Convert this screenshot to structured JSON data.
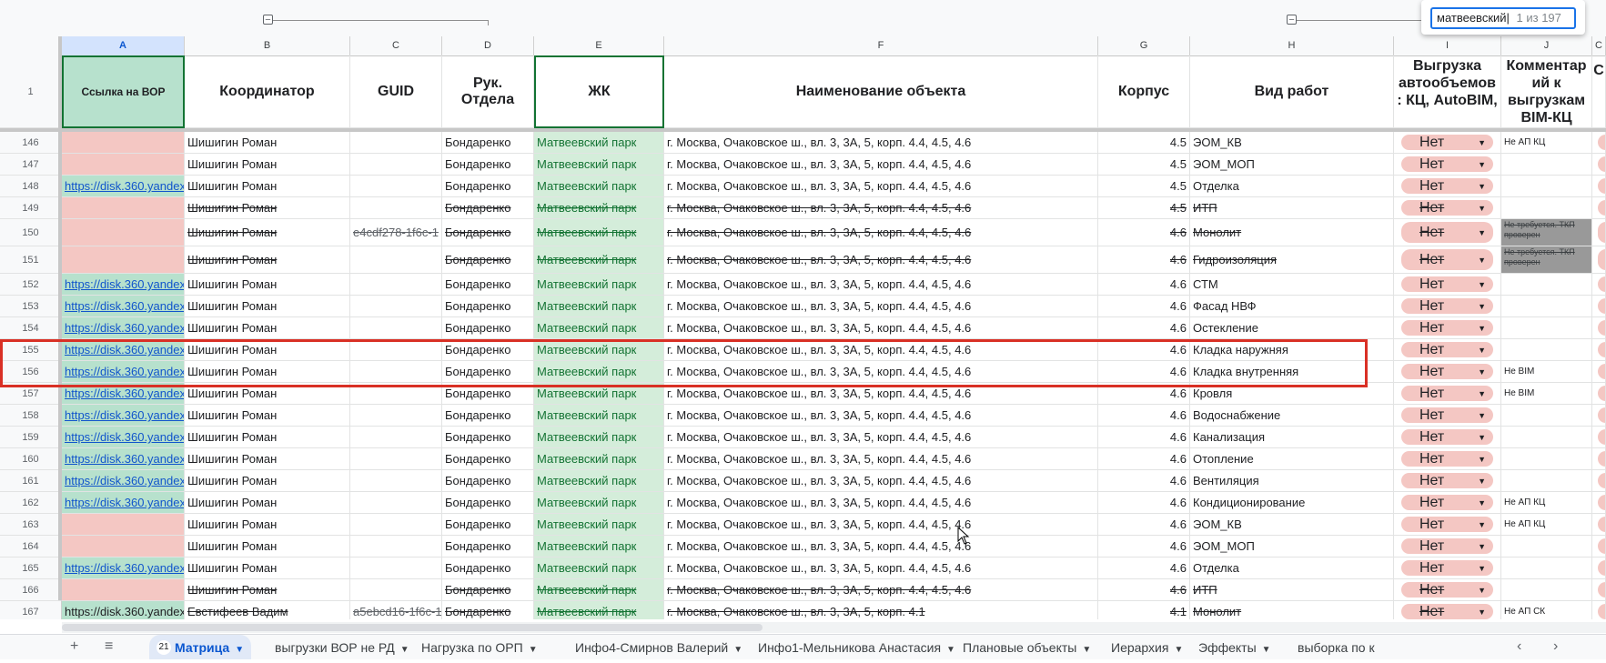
{
  "find": {
    "query": "матвеевский",
    "count": "1 из 197"
  },
  "columns": [
    "A",
    "B",
    "C",
    "D",
    "E",
    "F",
    "G",
    "H",
    "I",
    "J",
    "C"
  ],
  "header_row": {
    "num": "1",
    "A": "Ссылка на ВОР",
    "B": "Координатор",
    "C": "GUID",
    "D": "Рук. Отдела",
    "E": "ЖК",
    "F": "Наименование объекта",
    "G": "Корпус",
    "H": "Вид работ",
    "I": "Выгрузка автообъемов : КЦ, AutoBIM,",
    "J": "Комментар ий к выгрузкам BIM-КЦ",
    "K": "С"
  },
  "rows": [
    {
      "num": "146",
      "a": "",
      "b": "Шишигин Роман",
      "c": "",
      "d": "Бондаренко",
      "e": "Матвеевский парк",
      "f": "г. Москва, Очаковское ш., вл. 3, 3А, 5, корп. 4.4, 4.5, 4.6",
      "g": "4.5",
      "h": "ЭОМ_КВ",
      "i": "Нет",
      "j": "Не АП КЦ"
    },
    {
      "num": "147",
      "a": "",
      "b": "Шишигин Роман",
      "c": "",
      "d": "Бондаренко",
      "e": "Матвеевский парк",
      "f": "г. Москва, Очаковское ш., вл. 3, 3А, 5, корп. 4.4, 4.5, 4.6",
      "g": "4.5",
      "h": "ЭОМ_МОП",
      "i": "Нет",
      "j": ""
    },
    {
      "num": "148",
      "a": "https://disk.360.yandex",
      "b": "Шишигин Роман",
      "c": "",
      "d": "Бондаренко",
      "e": "Матвеевский парк",
      "f": "г. Москва, Очаковское ш., вл. 3, 3А, 5, корп. 4.4, 4.5, 4.6",
      "g": "4.5",
      "h": "Отделка",
      "i": "Нет",
      "j": ""
    },
    {
      "num": "149",
      "a": "",
      "b": "Шишигин Роман",
      "c": "",
      "d": "Бондаренко",
      "e": "Матвеевский парк",
      "f": "г. Москва, Очаковское ш., вл. 3, 3А, 5, корп. 4.4, 4.5, 4.6",
      "g": "4.5",
      "h": "ИТП",
      "i": "Нет",
      "j": ""
    },
    {
      "num": "150",
      "a": "",
      "b": "Шишигин Роман",
      "c": "e4cdf278-1f6c-1",
      "d": "Бондаренко",
      "e": "Матвеевский парк",
      "f": "г. Москва, Очаковское ш., вл. 3, 3А, 5, корп. 4.4, 4.5, 4.6",
      "g": "4.6",
      "h": "Монолит",
      "i": "Нет",
      "j": "Не требуется. ТКП проверен"
    },
    {
      "num": "151",
      "a": "",
      "b": "Шишигин Роман",
      "c": "",
      "d": "Бондаренко",
      "e": "Матвеевский парк",
      "f": "г. Москва, Очаковское ш., вл. 3, 3А, 5, корп. 4.4, 4.5, 4.6",
      "g": "4.6",
      "h": "Гидроизоляция",
      "i": "Нет",
      "j": "Не требуется. ТКП проверен"
    },
    {
      "num": "152",
      "a": "https://disk.360.yandex",
      "b": "Шишигин Роман",
      "c": "",
      "d": "Бондаренко",
      "e": "Матвеевский парк",
      "f": "г. Москва, Очаковское ш., вл. 3, 3А, 5, корп. 4.4, 4.5, 4.6",
      "g": "4.6",
      "h": "СТМ",
      "i": "Нет",
      "j": ""
    },
    {
      "num": "153",
      "a": "https://disk.360.yandex",
      "b": "Шишигин Роман",
      "c": "",
      "d": "Бондаренко",
      "e": "Матвеевский парк",
      "f": "г. Москва, Очаковское ш., вл. 3, 3А, 5, корп. 4.4, 4.5, 4.6",
      "g": "4.6",
      "h": "Фасад НВФ",
      "i": "Нет",
      "j": ""
    },
    {
      "num": "154",
      "a": "https://disk.360.yandex",
      "b": "Шишигин Роман",
      "c": "",
      "d": "Бондаренко",
      "e": "Матвеевский парк",
      "f": "г. Москва, Очаковское ш., вл. 3, 3А, 5, корп. 4.4, 4.5, 4.6",
      "g": "4.6",
      "h": "Остекление",
      "i": "Нет",
      "j": ""
    },
    {
      "num": "155",
      "a": "https://disk.360.yandex",
      "b": "Шишигин Роман",
      "c": "",
      "d": "Бондаренко",
      "e": "Матвеевский парк",
      "f": "г. Москва, Очаковское ш., вл. 3, 3А, 5, корп. 4.4, 4.5, 4.6",
      "g": "4.6",
      "h": "Кладка наружняя",
      "i": "Нет",
      "j": ""
    },
    {
      "num": "156",
      "a": "https://disk.360.yandex",
      "b": "Шишигин Роман",
      "c": "",
      "d": "Бондаренко",
      "e": "Матвеевский парк",
      "f": "г. Москва, Очаковское ш., вл. 3, 3А, 5, корп. 4.4, 4.5, 4.6",
      "g": "4.6",
      "h": "Кладка внутренняя",
      "i": "Нет",
      "j": "Не BIM"
    },
    {
      "num": "157",
      "a": "https://disk.360.yandex",
      "b": "Шишигин Роман",
      "c": "",
      "d": "Бондаренко",
      "e": "Матвеевский парк",
      "f": "г. Москва, Очаковское ш., вл. 3, 3А, 5, корп. 4.4, 4.5, 4.6",
      "g": "4.6",
      "h": "Кровля",
      "i": "Нет",
      "j": "Не BIM"
    },
    {
      "num": "158",
      "a": "https://disk.360.yandex",
      "b": "Шишигин Роман",
      "c": "",
      "d": "Бондаренко",
      "e": "Матвеевский парк",
      "f": "г. Москва, Очаковское ш., вл. 3, 3А, 5, корп. 4.4, 4.5, 4.6",
      "g": "4.6",
      "h": "Водоснабжение",
      "i": "Нет",
      "j": ""
    },
    {
      "num": "159",
      "a": "https://disk.360.yandex",
      "b": "Шишигин Роман",
      "c": "",
      "d": "Бондаренко",
      "e": "Матвеевский парк",
      "f": "г. Москва, Очаковское ш., вл. 3, 3А, 5, корп. 4.4, 4.5, 4.6",
      "g": "4.6",
      "h": "Канализация",
      "i": "Нет",
      "j": ""
    },
    {
      "num": "160",
      "a": "https://disk.360.yandex",
      "b": "Шишигин Роман",
      "c": "",
      "d": "Бондаренко",
      "e": "Матвеевский парк",
      "f": "г. Москва, Очаковское ш., вл. 3, 3А, 5, корп. 4.4, 4.5, 4.6",
      "g": "4.6",
      "h": "Отопление",
      "i": "Нет",
      "j": ""
    },
    {
      "num": "161",
      "a": "https://disk.360.yandex",
      "b": "Шишигин Роман",
      "c": "",
      "d": "Бондаренко",
      "e": "Матвеевский парк",
      "f": "г. Москва, Очаковское ш., вл. 3, 3А, 5, корп. 4.4, 4.5, 4.6",
      "g": "4.6",
      "h": "Вентиляция",
      "i": "Нет",
      "j": ""
    },
    {
      "num": "162",
      "a": "https://disk.360.yandex",
      "b": "Шишигин Роман",
      "c": "",
      "d": "Бондаренко",
      "e": "Матвеевский парк",
      "f": "г. Москва, Очаковское ш., вл. 3, 3А, 5, корп. 4.4, 4.5, 4.6",
      "g": "4.6",
      "h": "Кондиционирование",
      "i": "Нет",
      "j": "Не АП КЦ"
    },
    {
      "num": "163",
      "a": "",
      "b": "Шишигин Роман",
      "c": "",
      "d": "Бондаренко",
      "e": "Матвеевский парк",
      "f": "г. Москва, Очаковское ш., вл. 3, 3А, 5, корп. 4.4, 4.5, 4.6",
      "g": "4.6",
      "h": "ЭОМ_КВ",
      "i": "Нет",
      "j": "Не АП КЦ"
    },
    {
      "num": "164",
      "a": "",
      "b": "Шишигин Роман",
      "c": "",
      "d": "Бондаренко",
      "e": "Матвеевский парк",
      "f": "г. Москва, Очаковское ш., вл. 3, 3А, 5, корп. 4.4, 4.5, 4.6",
      "g": "4.6",
      "h": "ЭОМ_МОП",
      "i": "Нет",
      "j": ""
    },
    {
      "num": "165",
      "a": "https://disk.360.yandex",
      "b": "Шишигин Роман",
      "c": "",
      "d": "Бондаренко",
      "e": "Матвеевский парк",
      "f": "г. Москва, Очаковское ш., вл. 3, 3А, 5, корп. 4.4, 4.5, 4.6",
      "g": "4.6",
      "h": "Отделка",
      "i": "Нет",
      "j": ""
    },
    {
      "num": "166",
      "a": "",
      "b": "Шишигин Роман",
      "c": "",
      "d": "Бондаренко",
      "e": "Матвеевский парк",
      "f": "г. Москва, Очаковское ш., вл. 3, 3А, 5, корп. 4.4, 4.5, 4.6",
      "g": "4.6",
      "h": "ИТП",
      "i": "Нет",
      "j": ""
    },
    {
      "num": "167",
      "a": "https://disk.360.yandex",
      "b": "Евстифеев Вадим",
      "c": "a5ebcd16-1f6c-1",
      "d": "Бондаренко",
      "e": "Матвеевский парк",
      "f": "г. Москва, Очаковское ш., вл. 3, 3А, 5, корп. 4.1",
      "g": "4.1",
      "h": "Монолит",
      "i": "Нет",
      "j": "Не АП СК"
    }
  ],
  "tabs": {
    "add": "+",
    "menu": "≡",
    "active_badge": "21",
    "items": [
      "Матрица",
      "выгрузки ВОР не РД",
      "Нагрузка по ОРП",
      "Инфо4-Смирнов Валерий",
      "Инфо1-Мельникова Анастасия",
      "Плановые объекты",
      "Иерархия",
      "Эффекты",
      "выборка по к"
    ],
    "prev": "‹",
    "next": "›"
  }
}
